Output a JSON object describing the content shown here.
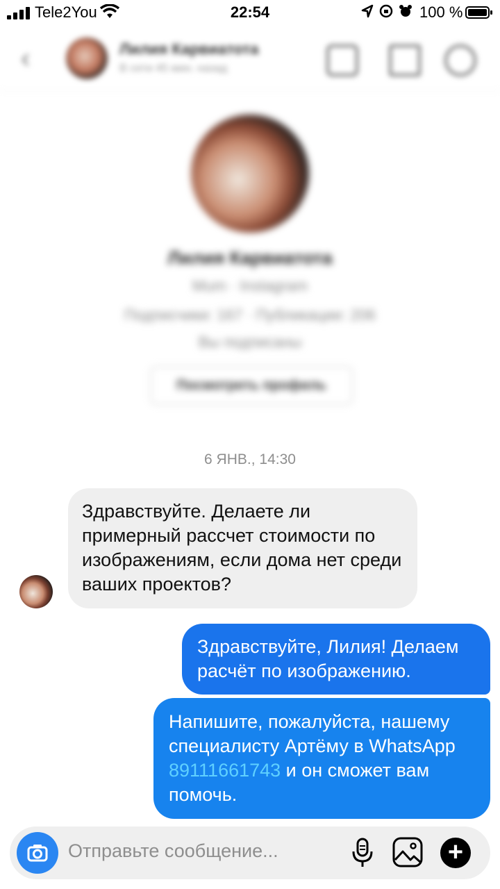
{
  "status_bar": {
    "carrier": "Tele2You",
    "time": "22:54",
    "battery": "100 %"
  },
  "header": {
    "back_icon": "chevron-left-icon",
    "name": "Лилия Карвиатота",
    "subtitle": "В сети 45 мин. назад",
    "icons": [
      "video-icon",
      "flag-icon",
      "info-icon"
    ]
  },
  "profile": {
    "name": "Лилия Карвиатота",
    "line1": "Mum · Instagram",
    "line2": "Подписчики: 167 · Публикации: 206",
    "line3": "Вы подписаны",
    "view_profile_label": "Посмотреть профиль"
  },
  "conversation": {
    "date_separator": "6 ЯНВ., 14:30",
    "incoming": {
      "text": "Здравствуйте. Делаете ли примерный рассчет стоимости по изображениям, если дома нет среди ваших проектов?"
    },
    "outgoing": [
      {
        "text": "Здравствуйте, Лилия! Делаем расчёт по изображению."
      },
      {
        "text_before": "Напишите, пожалуйста, нашему специалисту Артёму в WhatsApp ",
        "phone": "89111661743",
        "text_after": " и он сможет вам помочь."
      }
    ]
  },
  "composer": {
    "placeholder": "Отправьте сообщение...",
    "icons": [
      "camera-icon",
      "microphone-icon",
      "gallery-icon",
      "plus-icon"
    ]
  },
  "colors": {
    "outgoing_bubble": "#1a74ec",
    "incoming_bubble": "#efefef",
    "camera_button": "#2a86f2",
    "link": "#5fd0ff"
  }
}
